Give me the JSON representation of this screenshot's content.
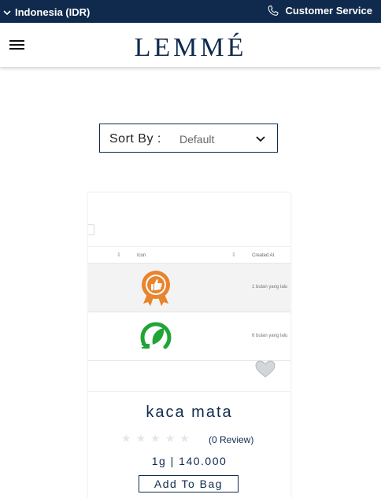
{
  "topbar": {
    "region_label": "Indonesia (IDR)",
    "customer_service_label": "Customer Service"
  },
  "header": {
    "logo_text": "LEMMÉ"
  },
  "sort": {
    "label": "Sort By :",
    "value": "Default"
  },
  "product": {
    "image_table": {
      "headers": [
        "Icon",
        "Created At"
      ],
      "rows": [
        {
          "icon": "thumbs-up-badge-icon",
          "created_at": "1 bulan yang lalu"
        },
        {
          "icon": "eco-plug-leaf-icon",
          "created_at": "6 bulan yang lalu"
        }
      ]
    },
    "name": "kaca mata",
    "rating": 0,
    "review_text": "(0 Review)",
    "price_text": "1g | 140.000",
    "add_button_label": "Add To Bag"
  },
  "colors": {
    "navy": "#0f2a4d",
    "orange": "#e8842c",
    "green": "#1fa535"
  }
}
